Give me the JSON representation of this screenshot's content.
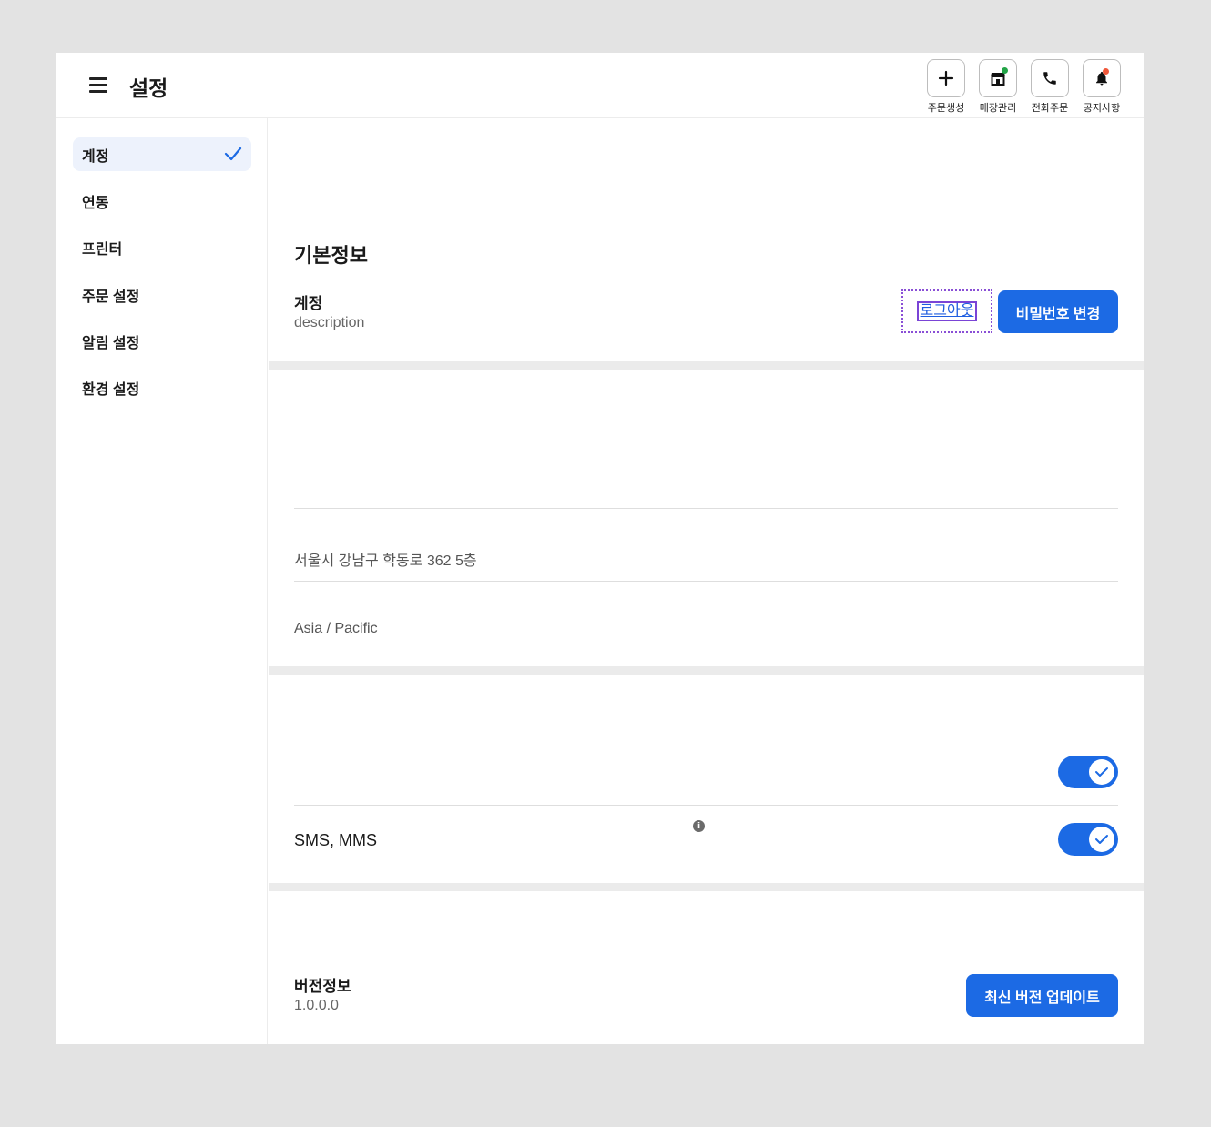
{
  "header": {
    "title": "설정",
    "quick_actions": [
      {
        "label": "주문생성",
        "icon": "plus-icon"
      },
      {
        "label": "매장관리",
        "icon": "store-icon",
        "dot_color": "#22a447"
      },
      {
        "label": "전화주문",
        "icon": "phone-icon"
      },
      {
        "label": "공지사항",
        "icon": "bell-icon",
        "dot_color": "#f0573a"
      }
    ]
  },
  "sidebar": {
    "items": [
      {
        "label": "계정",
        "active": true
      },
      {
        "label": "연동"
      },
      {
        "label": "프린터"
      },
      {
        "label": "주문 설정"
      },
      {
        "label": "알림 설정"
      },
      {
        "label": "환경 설정"
      }
    ]
  },
  "basic_info": {
    "title": "기본정보",
    "account_label": "계정",
    "account_desc": "description",
    "logout_label": "로그아웃",
    "change_password_label": "비밀번호 변경"
  },
  "store_info": {
    "address": "서울시 강남구 학동로 362 5층",
    "timezone": "Asia / Pacific"
  },
  "notifications": {
    "info_icon": "i",
    "toggle1_on": true,
    "sms_label": "SMS, MMS",
    "toggle2_on": true
  },
  "version": {
    "label": "버전정보",
    "value": "1.0.0.0",
    "update_label": "최신 버전 업데이트"
  },
  "colors": {
    "primary": "#1c6ae4",
    "active_nav_bg": "#edf2fc",
    "store_dot": "#22a447",
    "notice_dot": "#f0573a"
  }
}
